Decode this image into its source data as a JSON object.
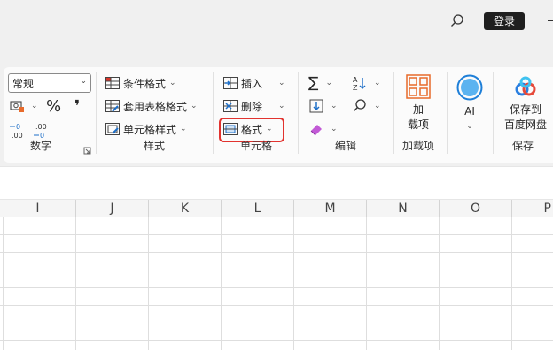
{
  "titlebar": {
    "login_label": "登录"
  },
  "ribbon": {
    "number_group": {
      "format_value": "常规",
      "percent_symbol": "%",
      "comma_symbol": "❜",
      "increase_decimal": "←0 .00",
      "decrease_decimal": ".00 →0",
      "label": "数字"
    },
    "styles_group": {
      "conditional_format": "条件格式",
      "table_format": "套用表格格式",
      "cell_styles": "单元格样式",
      "label": "样式"
    },
    "cells_group": {
      "insert": "插入",
      "delete": "删除",
      "format": "格式",
      "label": "单元格"
    },
    "editing_group": {
      "label": "编辑"
    },
    "addins_group": {
      "button_line1": "加",
      "button_line2": "载项",
      "label": "加载项"
    },
    "ai_group": {
      "label": "AI"
    },
    "save_group": {
      "button_line1": "保存到",
      "button_line2": "百度网盘",
      "label": "保存"
    }
  },
  "columns": [
    "I",
    "J",
    "K",
    "L",
    "M",
    "N",
    "O",
    "P"
  ],
  "colors": {
    "highlight": "#e2332f",
    "ai_ring": "#1e7fd8"
  }
}
